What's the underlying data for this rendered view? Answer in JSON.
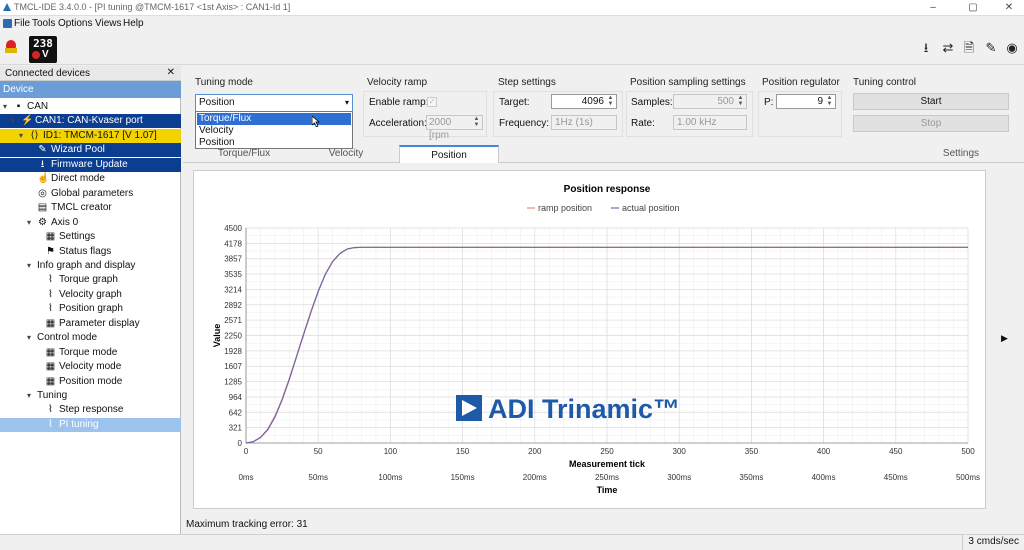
{
  "window": {
    "title": "TMCL-IDE 3.4.0.0 - [PI tuning @TMCM-1617 <1st Axis> : CAN1-Id 1]",
    "controls": [
      "–",
      "▢",
      "✕"
    ]
  },
  "menu": [
    "File",
    "Tools",
    "Options",
    "Views",
    "Help"
  ],
  "toolbar": {
    "display_value": "238",
    "display_sub": "V"
  },
  "sidebar": {
    "header": "Connected devices",
    "close": "✕",
    "device_label": "Device",
    "tree": [
      {
        "label": "CAN",
        "icon": "can-icon",
        "arrow": "▾",
        "style": ""
      },
      {
        "label": "CAN1: CAN-Kvaser port",
        "icon": "port-icon",
        "arrow": "▾",
        "style": "dark"
      },
      {
        "label": "ID1: TMCM-1617 [V 1.07]",
        "icon": "module-icon",
        "arrow": "▾",
        "style": "yellow"
      },
      {
        "label": "Wizard Pool",
        "icon": "wizard-icon",
        "arrow": "",
        "style": "dark"
      },
      {
        "label": "Firmware Update",
        "icon": "download-icon",
        "arrow": "",
        "style": "dark"
      },
      {
        "label": "Direct mode",
        "icon": "hand-icon",
        "arrow": "",
        "style": ""
      },
      {
        "label": "Global parameters",
        "icon": "globe-icon",
        "arrow": "",
        "style": ""
      },
      {
        "label": "TMCL creator",
        "icon": "document-icon",
        "arrow": "",
        "style": ""
      },
      {
        "label": "Axis 0",
        "icon": "axis-icon",
        "arrow": "▾",
        "style": ""
      },
      {
        "label": "Settings",
        "icon": "settings-icon",
        "arrow": "",
        "style": ""
      },
      {
        "label": "Status flags",
        "icon": "flag-icon",
        "arrow": "",
        "style": ""
      },
      {
        "label": "Info graph and display",
        "icon": "",
        "arrow": "▾",
        "style": ""
      },
      {
        "label": "Torque graph",
        "icon": "graph-icon",
        "arrow": "",
        "style": ""
      },
      {
        "label": "Velocity graph",
        "icon": "graph-icon",
        "arrow": "",
        "style": ""
      },
      {
        "label": "Position graph",
        "icon": "graph-icon",
        "arrow": "",
        "style": ""
      },
      {
        "label": "Parameter display",
        "icon": "table-icon",
        "arrow": "",
        "style": ""
      },
      {
        "label": "Control mode",
        "icon": "",
        "arrow": "▾",
        "style": ""
      },
      {
        "label": "Torque mode",
        "icon": "table-icon",
        "arrow": "",
        "style": ""
      },
      {
        "label": "Velocity mode",
        "icon": "table-icon",
        "arrow": "",
        "style": ""
      },
      {
        "label": "Position mode",
        "icon": "table-icon",
        "arrow": "",
        "style": ""
      },
      {
        "label": "Tuning",
        "icon": "",
        "arrow": "▾",
        "style": ""
      },
      {
        "label": "Step response",
        "icon": "graph-icon",
        "arrow": "",
        "style": ""
      },
      {
        "label": "PI tuning",
        "icon": "graph-icon",
        "arrow": "",
        "style": "light"
      }
    ]
  },
  "tuning_mode": {
    "title": "Tuning mode",
    "selected": "Position",
    "options": [
      "Torque/Flux",
      "Velocity",
      "Position"
    ],
    "highlighted": "Torque/Flux"
  },
  "velocity_ramp": {
    "title": "Velocity ramp",
    "enable_label": "Enable ramp:",
    "enabled": false,
    "accel_label": "Acceleration:",
    "accel_value": "2000 [rpm"
  },
  "step_settings": {
    "title": "Step settings",
    "target_label": "Target:",
    "target_value": "4096",
    "freq_label": "Frequency:",
    "freq_value": "1Hz (1s)"
  },
  "position_sampling": {
    "title": "Position sampling settings",
    "samples_label": "Samples:",
    "samples_value": "500",
    "rate_label": "Rate:",
    "rate_value": "1.00 kHz"
  },
  "position_regulator": {
    "title": "Position regulator",
    "p_label": "P:",
    "p_value": "9"
  },
  "tuning_control": {
    "title": "Tuning control",
    "start_label": "Start",
    "stop_label": "Stop"
  },
  "tabs": [
    "Torque/Flux",
    "Velocity",
    "Position",
    "Settings"
  ],
  "active_tab": "Position",
  "chart_data": {
    "type": "line",
    "title": "Position response",
    "xlabel": "Measurement tick",
    "x2label": "Time",
    "ylabel": "Value",
    "xlim": [
      0,
      500
    ],
    "ylim": [
      0,
      4500
    ],
    "x_ticks": [
      "0",
      "50",
      "100",
      "150",
      "200",
      "250",
      "300",
      "350",
      "400",
      "450",
      "500"
    ],
    "x2_ticks": [
      "0ms",
      "50ms",
      "100ms",
      "150ms",
      "200ms",
      "250ms",
      "300ms",
      "350ms",
      "400ms",
      "450ms",
      "500ms"
    ],
    "y_ticks": [
      "4500",
      "4178",
      "3857",
      "3535",
      "3214",
      "2892",
      "2571",
      "2250",
      "1928",
      "1607",
      "1285",
      "964",
      "642",
      "321",
      "0"
    ],
    "legend_position": "top-center",
    "grid": true,
    "series": [
      {
        "name": "ramp position",
        "color": "#e8877f",
        "x": [
          0,
          5,
          10,
          15,
          20,
          25,
          30,
          35,
          40,
          45,
          50,
          55,
          60,
          65,
          70,
          75,
          80,
          100,
          200,
          300,
          400,
          500
        ],
        "y": [
          0,
          30,
          120,
          290,
          560,
          920,
          1350,
          1820,
          2300,
          2760,
          3180,
          3540,
          3800,
          3970,
          4060,
          4090,
          4096,
          4096,
          4096,
          4096,
          4096,
          4096
        ]
      },
      {
        "name": "actual position",
        "color": "#6e6aa8",
        "x": [
          0,
          5,
          10,
          15,
          20,
          25,
          30,
          35,
          40,
          45,
          50,
          55,
          60,
          65,
          70,
          75,
          80,
          100,
          200,
          300,
          400,
          500
        ],
        "y": [
          0,
          25,
          110,
          275,
          540,
          900,
          1330,
          1800,
          2280,
          2740,
          3170,
          3530,
          3795,
          3965,
          4058,
          4090,
          4096,
          4096,
          4096,
          4096,
          4096,
          4096
        ]
      }
    ]
  },
  "watermark": "ADI Trinamic™",
  "status_message": "Maximum tracking error: 31",
  "status_rate": "3 cmds/sec",
  "right_arrow": "▶"
}
